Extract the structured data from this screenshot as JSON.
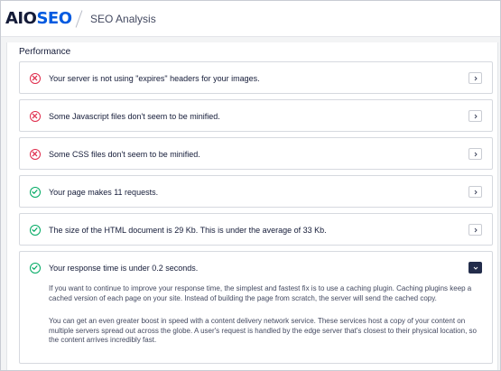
{
  "header": {
    "logo_aio": "AIO",
    "logo_seo": "SEO",
    "title": "SEO Analysis"
  },
  "section": {
    "title": "Performance"
  },
  "items": [
    {
      "status": "fail",
      "label": "Your server is not using \"expires\" headers for your images."
    },
    {
      "status": "fail",
      "label": "Some Javascript files don't seem to be minified."
    },
    {
      "status": "fail",
      "label": "Some CSS files don't seem to be minified."
    },
    {
      "status": "pass",
      "label": "Your page makes 11 requests."
    },
    {
      "status": "pass",
      "label": "The size of the HTML document is 29 Kb. This is under the average of 33 Kb."
    },
    {
      "status": "pass",
      "label": "Your response time is under 0.2 seconds.",
      "expanded": true,
      "details": [
        "If you want to continue to improve your response time, the simplest and fastest fix is to use a caching plugin. Caching plugins keep a cached version of each page on your site. Instead of building the page from scratch, the server will send the cached copy.",
        "You can get an even greater boost in speed with a content delivery network service. These services host a copy of your content on multiple servers spread out across the globe. A user's request is handled by the edge server that's closest to their physical location, so the content arrives incredibly fast."
      ]
    }
  ],
  "colors": {
    "fail": "#df2a4a",
    "pass": "#00aa63",
    "brand": "#005ae0",
    "toggle_open": "#232d4b"
  },
  "icons": {
    "fail": "x-circle-icon",
    "pass": "check-circle-icon",
    "collapsed": "chevron-right-icon",
    "expanded": "chevron-down-icon"
  }
}
